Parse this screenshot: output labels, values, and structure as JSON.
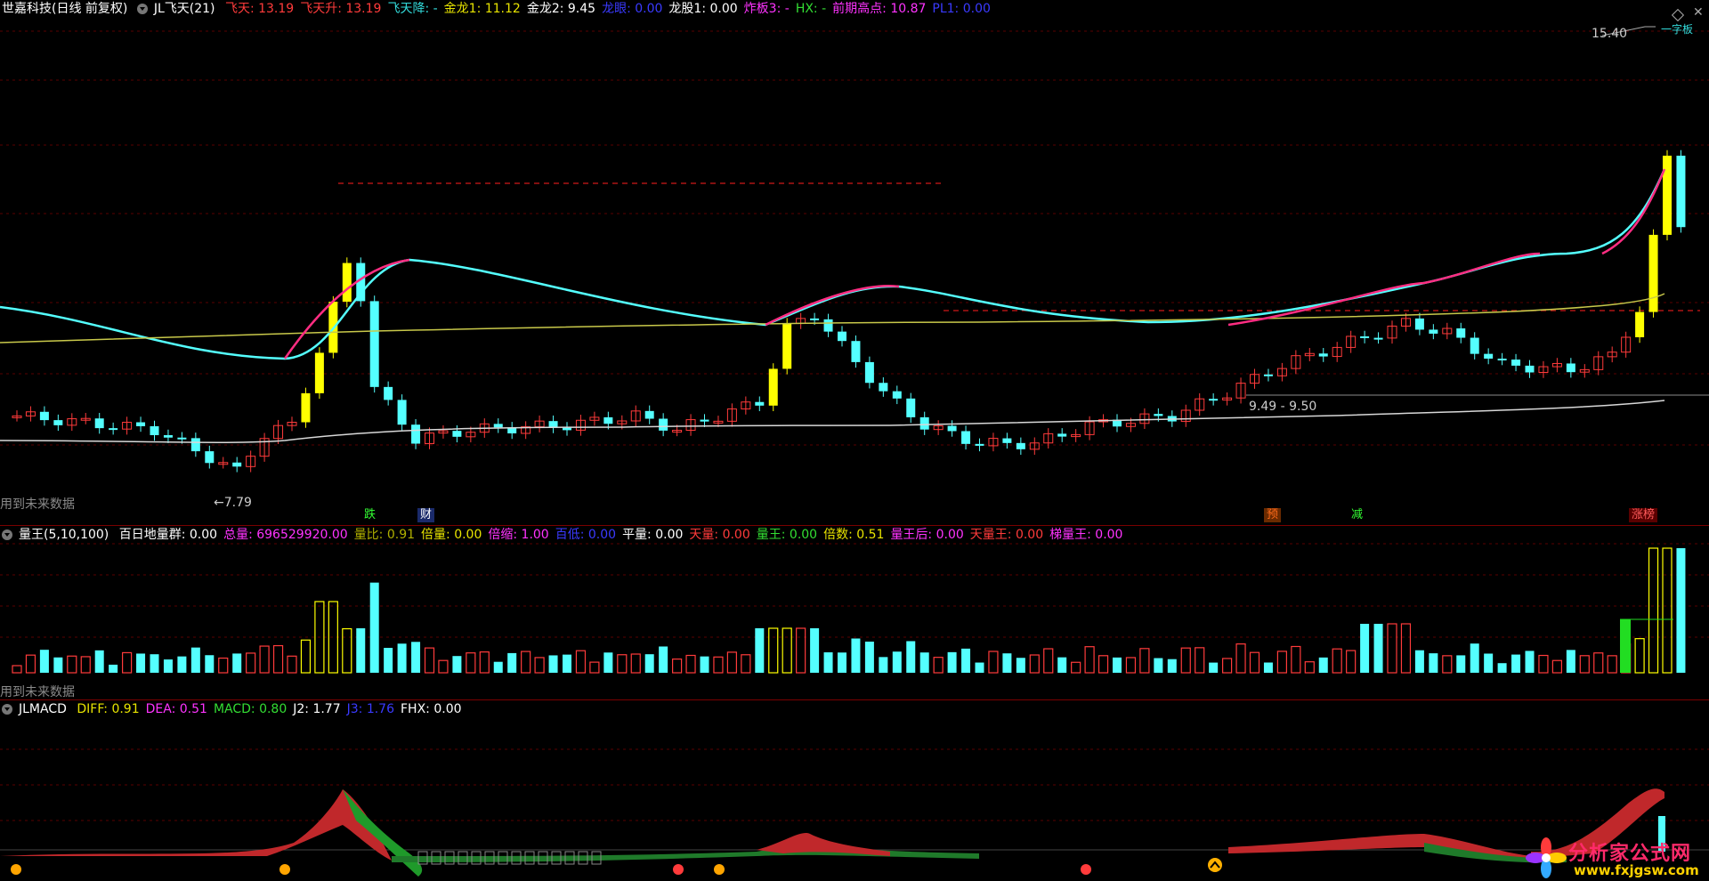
{
  "main": {
    "title": "世嘉科技(日线 前复权)",
    "indicator": "JL飞天(21)",
    "fields": [
      {
        "label": "飞天:",
        "value": "13.19",
        "color": "#ff3b3b"
      },
      {
        "label": "飞天升:",
        "value": "13.19",
        "color": "#ff3b3b"
      },
      {
        "label": "飞天降:",
        "value": "-",
        "color": "#33dddd"
      },
      {
        "label": "金龙1:",
        "value": "11.12",
        "color": "#e8e400"
      },
      {
        "label": "金龙2:",
        "value": "9.45",
        "color": "#ffffff"
      },
      {
        "label": "龙眼:",
        "value": "0.00",
        "color": "#3a3aff"
      },
      {
        "label": "龙股1:",
        "value": "0.00",
        "color": "#ffffff"
      },
      {
        "label": "炸板3:",
        "value": "-",
        "color": "#ff33ff"
      },
      {
        "label": "HX:",
        "value": "-",
        "color": "#33dd33"
      },
      {
        "label": "前期高点:",
        "value": "10.87",
        "color": "#ff33ff"
      },
      {
        "label": "PL1:",
        "value": "0.00",
        "color": "#3a3aff"
      }
    ],
    "price_high": "15.40",
    "price_low": "7.79",
    "range_label": "9.49 - 9.50",
    "future_note": "用到未来数据",
    "top_right_tag": "一字板",
    "signals": [
      {
        "text": "跌",
        "color": "#33ff33"
      },
      {
        "text": "财",
        "color": "#ffffff"
      },
      {
        "text": "预",
        "color": "#ff6b1a"
      },
      {
        "text": "减",
        "color": "#33ff33"
      },
      {
        "text": "涨榜",
        "color": "#ff5b5b"
      }
    ]
  },
  "volume": {
    "indicator": "量王(5,10,100)",
    "fields": [
      {
        "label": "百日地量群:",
        "value": "0.00",
        "color": "#ffffff"
      },
      {
        "label": "总量:",
        "value": "696529920.00",
        "color": "#ff33ff"
      },
      {
        "label": "量比:",
        "value": "0.91",
        "color": "#b0b000"
      },
      {
        "label": "倍量:",
        "value": "0.00",
        "color": "#e8e400"
      },
      {
        "label": "倍缩:",
        "value": "1.00",
        "color": "#ff33ff"
      },
      {
        "label": "百低:",
        "value": "0.00",
        "color": "#3a3aff"
      },
      {
        "label": "平量:",
        "value": "0.00",
        "color": "#ffffff"
      },
      {
        "label": "天量:",
        "value": "0.00",
        "color": "#ff3b3b"
      },
      {
        "label": "量王:",
        "value": "0.00",
        "color": "#33dd33"
      },
      {
        "label": "倍数:",
        "value": "0.51",
        "color": "#e8e400"
      },
      {
        "label": "量王后:",
        "value": "0.00",
        "color": "#ff33ff"
      },
      {
        "label": "天量王:",
        "value": "0.00",
        "color": "#ff3b3b"
      },
      {
        "label": "梯量王:",
        "value": "0.00",
        "color": "#ff33ff"
      }
    ],
    "future_note": "用到未来数据"
  },
  "macd": {
    "indicator": "JLMACD",
    "fields": [
      {
        "label": "DIFF:",
        "value": "0.91",
        "color": "#e8e400"
      },
      {
        "label": "DEA:",
        "value": "0.51",
        "color": "#ff33ff"
      },
      {
        "label": "MACD:",
        "value": "0.80",
        "color": "#33dd33"
      },
      {
        "label": "J2:",
        "value": "1.77",
        "color": "#ffffff"
      },
      {
        "label": "J3:",
        "value": "1.76",
        "color": "#3a3aff"
      },
      {
        "label": "FHX:",
        "value": "0.00",
        "color": "#ffffff"
      }
    ]
  },
  "watermark": {
    "title": "分析家公式网",
    "url": "www.fxjgsw.com"
  }
}
